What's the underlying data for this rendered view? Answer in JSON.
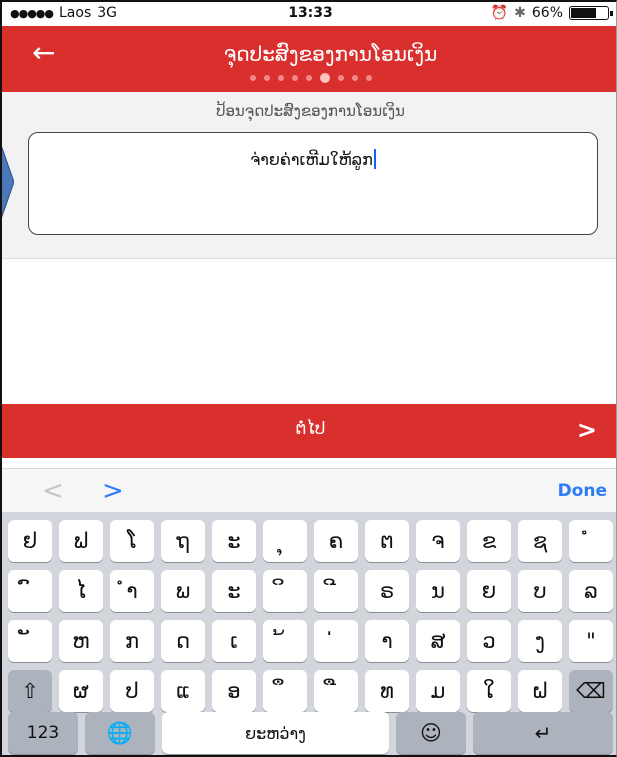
{
  "status_bar": {
    "signal": "●●●●●",
    "carrier": "Laos",
    "network": "3G",
    "time": "13:33",
    "alarm_icon": "alarm-icon",
    "bluetooth_icon": "bluetooth-icon",
    "battery": "66%",
    "battery_level": 0.66
  },
  "header": {
    "back_icon": "←",
    "title": "ຈຸດປະສົງຂອງການໂອນເງິນ",
    "pager_total": 9,
    "pager_active": 6
  },
  "form": {
    "caption": "ປ້ອນຈຸດປະສົງຂອງການໂອນເງິນ",
    "value": "ຈ່າຍຄ່າເຫີມໃຫ້ລູກ"
  },
  "next_bar": {
    "label": "ຕໍ່ໄປ",
    "chevron": ">"
  },
  "accessory": {
    "prev": "<",
    "next": ">",
    "done": "Done"
  },
  "keyboard": {
    "row1": [
      "ຢ",
      "ຟ",
      "ໂ",
      "ຖ",
      "ະ",
      "ຸ",
      "ຄ",
      "ຕ",
      "ຈ",
      "ຂ",
      "ຊ",
      "ໍ"
    ],
    "row2": [
      "ົ",
      "ໄ",
      "ຳ",
      "ພ",
      "ະ",
      "ິ",
      "ີ",
      "ຣ",
      "ນ",
      "ຍ",
      "ບ",
      "ລ"
    ],
    "row3": [
      "ັ",
      "ຫ",
      "ກ",
      "ດ",
      "ເ",
      "້",
      "່",
      "າ",
      "ສ",
      "ວ",
      "ງ",
      "\""
    ],
    "row4": [
      "⇧",
      "ຜ",
      "ປ",
      "ແ",
      "ອ",
      "ຶ",
      "ື",
      "ທ",
      "ມ",
      "ໃ",
      "ຝ",
      "⌫"
    ],
    "row5": {
      "numbers": "123",
      "globe": "🌐",
      "space": "ຍະຫວ່າງ",
      "emoji": "☺",
      "return": "↵"
    }
  },
  "colors": {
    "brand_red": "#d9302e",
    "accent_blue": "#2e7bf6"
  }
}
